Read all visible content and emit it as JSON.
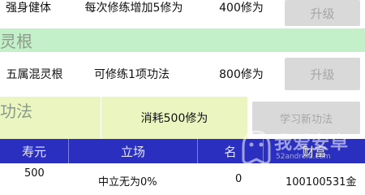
{
  "upgrade_rows": [
    {
      "name": "强身健体",
      "effect": "每次修练增加5修为",
      "cost": "400修为",
      "button": "升级"
    },
    {
      "name": "五属混灵根",
      "effect": "可修练1项功法",
      "cost": "800修为",
      "button": "升级"
    }
  ],
  "sections": {
    "linggen": "灵根",
    "gongfa": "功法"
  },
  "gongfa": {
    "cost_text": "消耗500修为",
    "learn_button": "学习新功法"
  },
  "table": {
    "headers": [
      "寿元",
      "立场",
      "名",
      "财富"
    ],
    "row": {
      "lifespan": "500",
      "stance": "中立无为0%",
      "fame": "0",
      "wealth": "100100531金"
    }
  },
  "watermark": {
    "text": "我爱安卓",
    "url": "52android.com"
  },
  "colors": {
    "section_green": "#c3f0c8",
    "gongfa_yellow": "#eaf5c0",
    "header_blue": "#2b2fbf",
    "button_gray": "#d9d9d9"
  }
}
